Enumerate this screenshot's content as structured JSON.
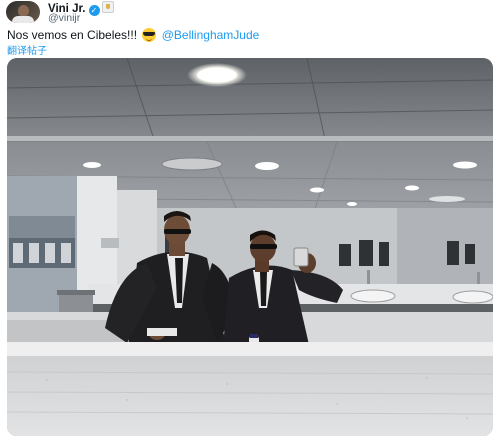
{
  "post": {
    "author_name": "Vini Jr.",
    "author_handle": "@vinijr",
    "text_main": "Nos vemos en Cibeles!!! ",
    "mention": "@BellinghamJude",
    "translate_label": "翻译帖子",
    "emoji": "smiling-face-with-sunglasses",
    "verified_color": "#1d9bf0"
  },
  "media": {
    "kind": "photo",
    "description_icon": "mirror-selfie-photo"
  }
}
